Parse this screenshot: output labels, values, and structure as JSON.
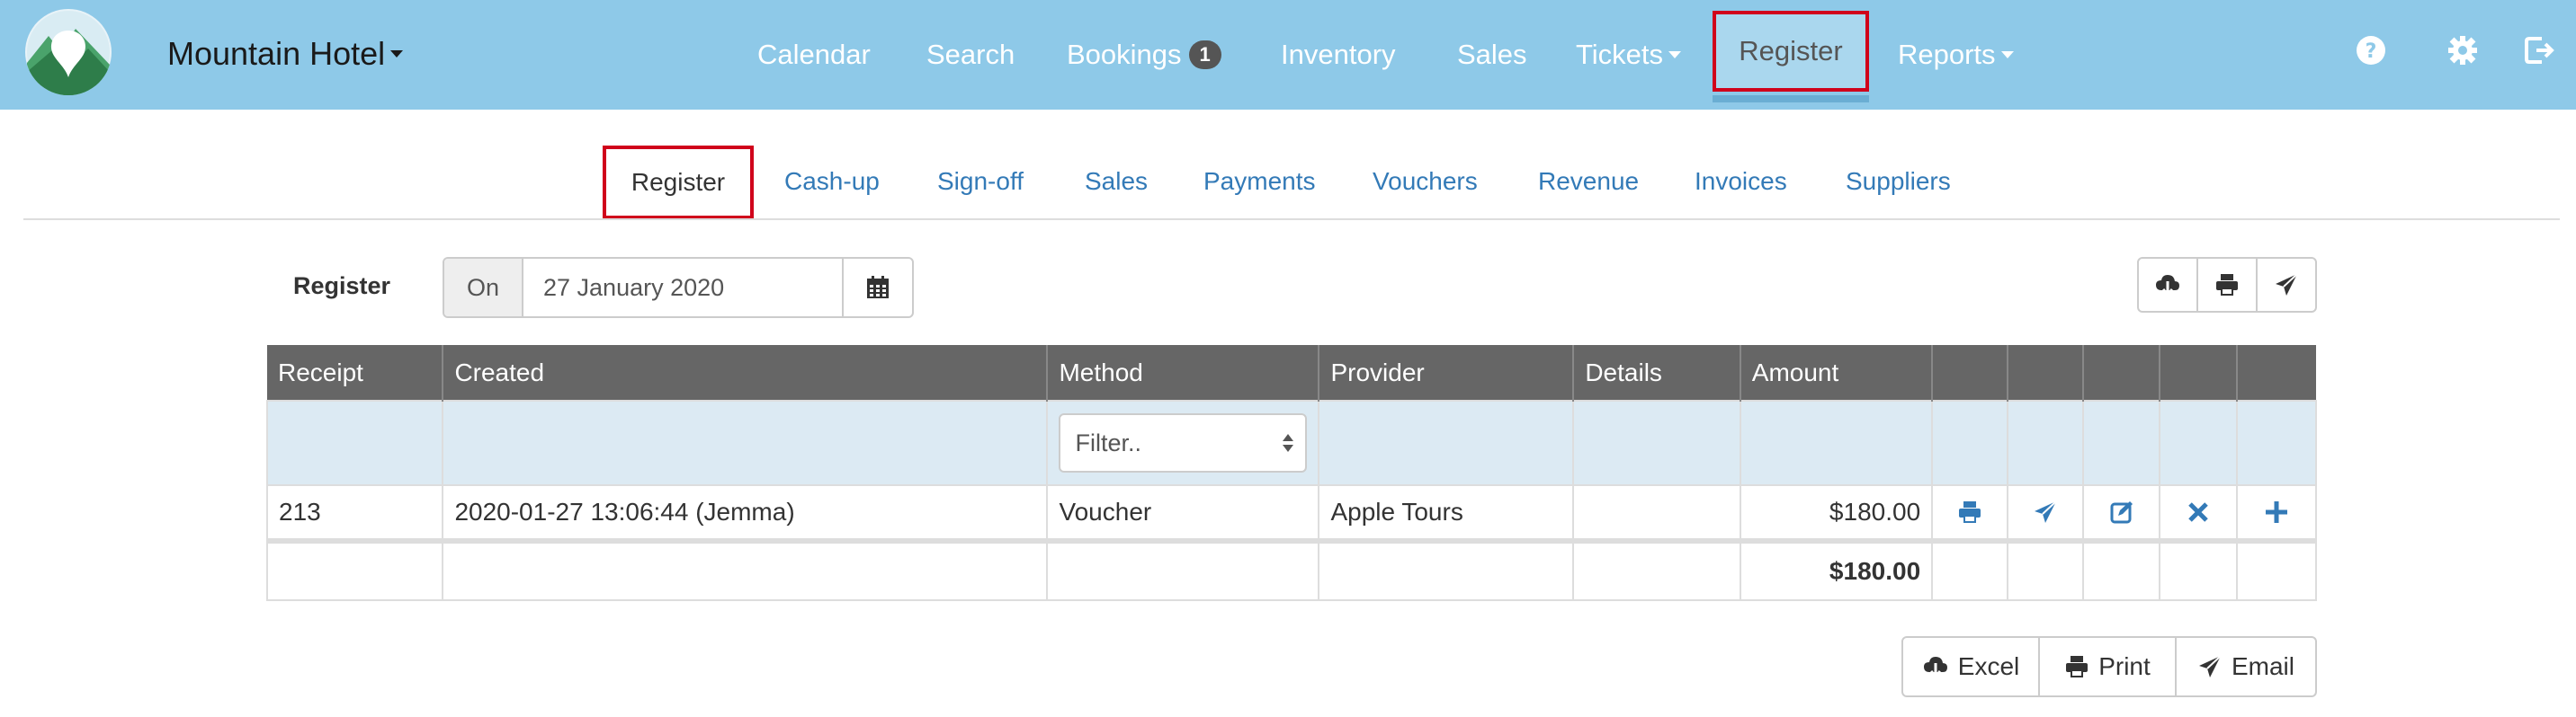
{
  "header": {
    "hotel_name": "Mountain Hotel",
    "nav": [
      {
        "label": "Calendar"
      },
      {
        "label": "Search"
      },
      {
        "label": "Bookings",
        "badge": "1"
      },
      {
        "label": "Inventory"
      },
      {
        "label": "Sales"
      },
      {
        "label": "Tickets",
        "dropdown": true
      },
      {
        "label": "Register",
        "active": true
      },
      {
        "label": "Reports",
        "dropdown": true
      }
    ],
    "right_icons": [
      "help-icon",
      "gear-icon",
      "logout-icon"
    ]
  },
  "subnav": {
    "tabs": [
      {
        "label": "Register",
        "active": true
      },
      {
        "label": "Cash-up"
      },
      {
        "label": "Sign-off"
      },
      {
        "label": "Sales"
      },
      {
        "label": "Payments"
      },
      {
        "label": "Vouchers"
      },
      {
        "label": "Revenue"
      },
      {
        "label": "Invoices"
      },
      {
        "label": "Suppliers"
      }
    ]
  },
  "register": {
    "label": "Register",
    "on_label": "On",
    "date": "27 January 2020",
    "top_actions": [
      "download-icon",
      "print-icon",
      "send-icon"
    ]
  },
  "table": {
    "columns": [
      "Receipt",
      "Created",
      "Method",
      "Provider",
      "Details",
      "Amount"
    ],
    "filter_placeholder": "Filter..",
    "rows": [
      {
        "receipt": "213",
        "created": "2020-01-27 13:06:44 (Jemma)",
        "method": "Voucher",
        "provider": "Apple Tours",
        "details": "",
        "amount": "$180.00",
        "actions": [
          "print-icon",
          "send-icon",
          "edit-icon",
          "delete-icon",
          "add-icon"
        ]
      }
    ],
    "total": "$180.00"
  },
  "bottom_actions": [
    {
      "label": "Excel",
      "icon": "download-icon"
    },
    {
      "label": "Print",
      "icon": "print-icon"
    },
    {
      "label": "Email",
      "icon": "send-icon"
    }
  ],
  "colors": {
    "header_bg": "#8ec9e8",
    "link": "#337ab7",
    "table_header": "#666666",
    "filter_row": "#dceaf3",
    "highlight": "#d0021b"
  }
}
